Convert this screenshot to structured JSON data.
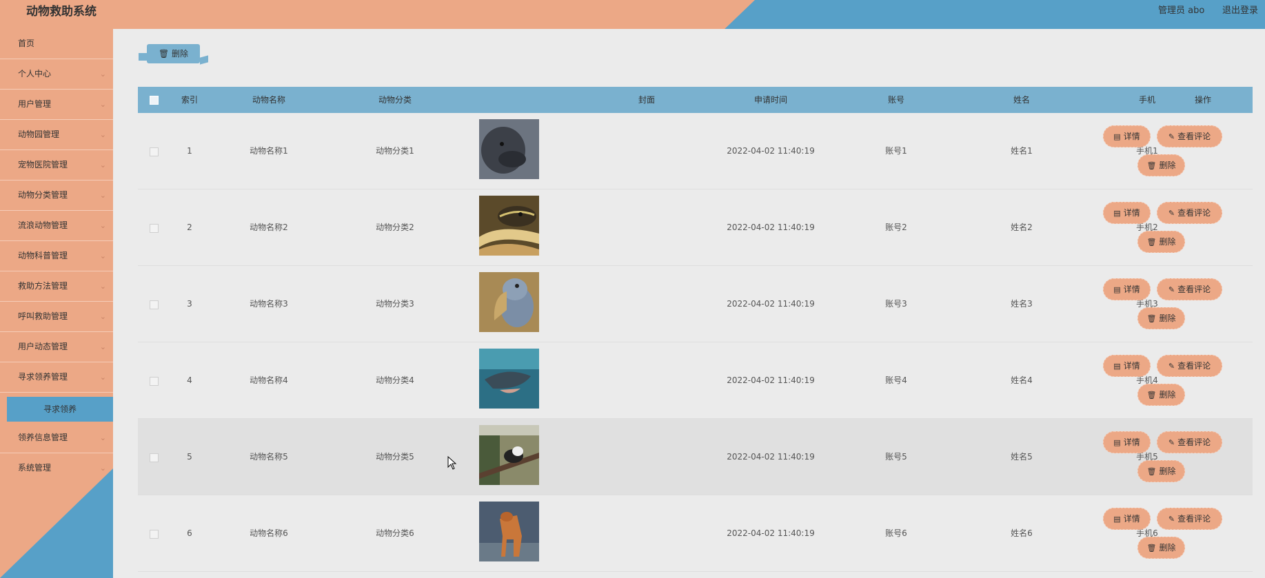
{
  "header": {
    "title": "动物救助系统",
    "admin_label": "管理员 abo",
    "logout_label": "退出登录"
  },
  "sidebar": {
    "items": [
      {
        "label": "首页",
        "chevron": false
      },
      {
        "label": "个人中心",
        "chevron": true
      },
      {
        "label": "用户管理",
        "chevron": true
      },
      {
        "label": "动物园管理",
        "chevron": true
      },
      {
        "label": "宠物医院管理",
        "chevron": true
      },
      {
        "label": "动物分类管理",
        "chevron": true
      },
      {
        "label": "流浪动物管理",
        "chevron": true
      },
      {
        "label": "动物科普管理",
        "chevron": true
      },
      {
        "label": "救助方法管理",
        "chevron": true
      },
      {
        "label": "呼叫救助管理",
        "chevron": true
      },
      {
        "label": "用户动态管理",
        "chevron": true
      },
      {
        "label": "寻求领养管理",
        "chevron": true
      }
    ],
    "active_sub": "寻求领养",
    "items_after": [
      {
        "label": "领养信息管理",
        "chevron": true
      },
      {
        "label": "系统管理",
        "chevron": true
      }
    ]
  },
  "toolbar": {
    "delete_label": "删除"
  },
  "table": {
    "columns": [
      "索引",
      "动物名称",
      "动物分类",
      "封面",
      "申请时间",
      "账号",
      "姓名",
      "手机",
      "操作"
    ],
    "rows": [
      {
        "index": "1",
        "name": "动物名称1",
        "category": "动物分类1",
        "cover": "dark-furred-animal",
        "time": "2022-04-02 11:40:19",
        "account": "账号1",
        "realname": "姓名1",
        "phone": "手机1"
      },
      {
        "index": "2",
        "name": "动物名称2",
        "category": "动物分类2",
        "cover": "snake",
        "time": "2022-04-02 11:40:19",
        "account": "账号2",
        "realname": "姓名2",
        "phone": "手机2"
      },
      {
        "index": "3",
        "name": "动物名称3",
        "category": "动物分类3",
        "cover": "shoebill-bird",
        "time": "2022-04-02 11:40:19",
        "account": "账号3",
        "realname": "姓名3",
        "phone": "手机3"
      },
      {
        "index": "4",
        "name": "动物名称4",
        "category": "动物分类4",
        "cover": "dolphin",
        "time": "2022-04-02 11:40:19",
        "account": "账号4",
        "realname": "姓名4",
        "phone": "手机4"
      },
      {
        "index": "5",
        "name": "动物名称5",
        "category": "动物分类5",
        "cover": "bird-on-branch",
        "time": "2022-04-02 11:40:19",
        "account": "账号5",
        "realname": "姓名5",
        "phone": "手机5"
      },
      {
        "index": "6",
        "name": "动物名称6",
        "category": "动物分类6",
        "cover": "wild-dog",
        "time": "2022-04-02 11:40:19",
        "account": "账号6",
        "realname": "姓名6",
        "phone": "手机6"
      }
    ],
    "actions": {
      "detail": "详情",
      "comments": "查看评论",
      "delete": "删除"
    }
  },
  "colors": {
    "salmon": "#eca886",
    "blue": "#57a0c8",
    "header_row": "#7ab1cf"
  }
}
